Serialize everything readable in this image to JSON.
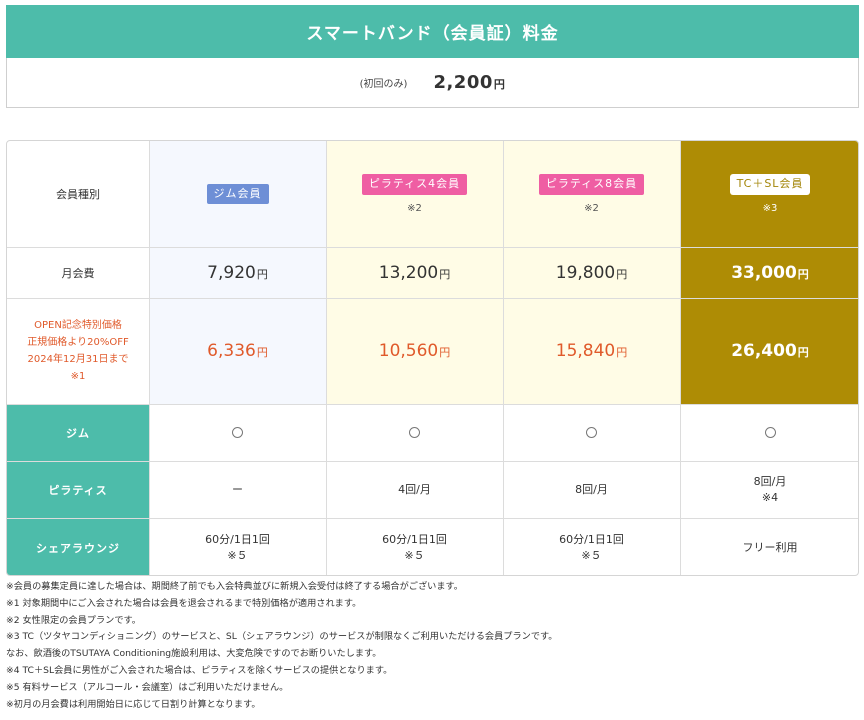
{
  "band": {
    "title": "スマートバンド（会員証）料金",
    "once_label": "(初回のみ)",
    "price": "2,200",
    "yen": "円"
  },
  "table": {
    "row_labels": {
      "member_type": "会員種別",
      "monthly_fee": "月会費",
      "open_campaign": [
        "OPEN記念特別価格",
        "正規価格より20%OFF",
        "2024年12月31日まで",
        "※1"
      ]
    },
    "plans": [
      {
        "name": "ジム会員",
        "note": "",
        "monthly": "7,920",
        "campaign": "6,336"
      },
      {
        "name": "ピラティス4会員",
        "note": "※2",
        "monthly": "13,200",
        "campaign": "10,560"
      },
      {
        "name": "ピラティス8会員",
        "note": "※2",
        "monthly": "19,800",
        "campaign": "15,840"
      },
      {
        "name": "TC＋SL会員",
        "note": "※3",
        "monthly": "33,000",
        "campaign": "26,400"
      }
    ],
    "features": [
      {
        "label": "ジム",
        "values": [
          [
            "〇"
          ],
          [
            "〇"
          ],
          [
            "〇"
          ],
          [
            "〇"
          ]
        ]
      },
      {
        "label": "ピラティス",
        "values": [
          [
            "ー"
          ],
          [
            "4回/月"
          ],
          [
            "8回/月"
          ],
          [
            "8回/月",
            "※4"
          ]
        ]
      },
      {
        "label": "シェアラウンジ",
        "values": [
          [
            "60分/1日1回",
            "※５"
          ],
          [
            "60分/1日1回",
            "※５"
          ],
          [
            "60分/1日1回",
            "※５"
          ],
          [
            "フリー利用"
          ]
        ]
      }
    ],
    "yen": "円"
  },
  "footnotes": [
    "※会員の募集定員に達した場合は、期間終了前でも入会特典並びに新規入会受付は終了する場合がございます。",
    "※1 対象期間中にご入会された場合は会員を退会されるまで特別価格が適用されます。",
    "※2 女性限定の会員プランです。",
    "※3 TC（ツタヤコンディショニング）のサービスと、SL（シェアラウンジ）のサービスが制限なくご利用いただける会員プランです。",
    "なお、飲酒後のTSUTAYA Conditioning施設利用は、大変危険ですのでお断りいたします。",
    "※4 TC＋SL会員に男性がご入会された場合は、ピラティスを除くサービスの提供となります。",
    "※5 有料サービス（アルコール・会議室）はご利用いただけません。",
    "※初月の月会費は利用開始日に応じて日割り計算となります。"
  ],
  "colors": {
    "accent_teal": "#4dbcaa",
    "gym_bg": "#f5f8fe",
    "pilates_bg": "#fffce6",
    "gold": "#ae8c05",
    "campaign_red": "#e05a2b"
  }
}
